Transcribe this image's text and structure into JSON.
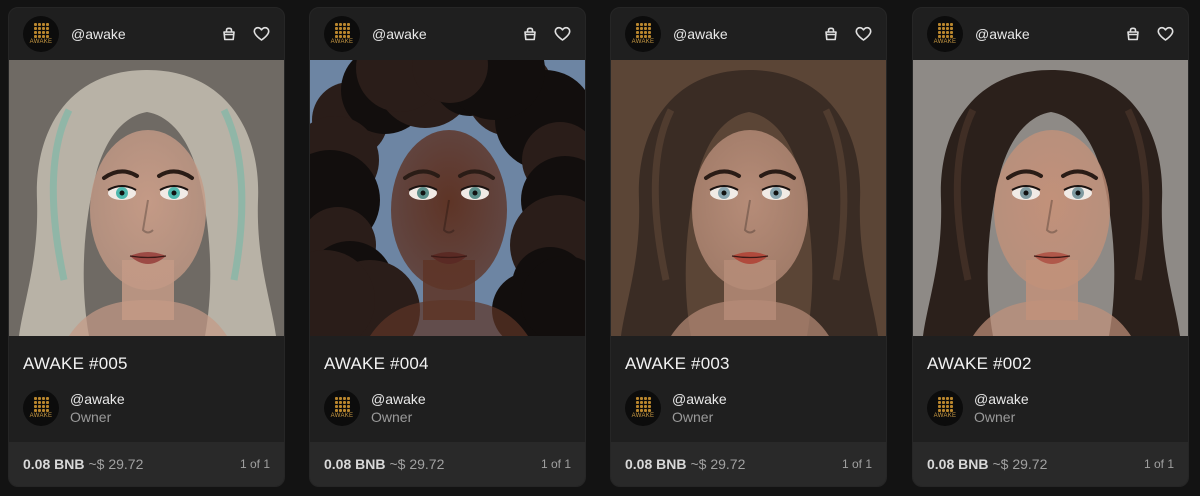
{
  "cards": [
    {
      "header_user": "@awake",
      "title": "AWAKE #005",
      "owner_name": "@awake",
      "owner_role": "Owner",
      "price": "0.08 BNB",
      "usd": "~$ 29.72",
      "edition": "1 of 1",
      "logo_text": "AWAKE",
      "palette": {
        "bg": "#6f6a64",
        "hair": "#b8b2a6",
        "hair_accent": "#7fb8a8",
        "skin": "#c49a86",
        "eyes": "#4fb8ae",
        "lips": "#9c4a44"
      }
    },
    {
      "header_user": "@awake",
      "title": "AWAKE #004",
      "owner_name": "@awake",
      "owner_role": "Owner",
      "price": "0.08 BNB",
      "usd": "~$ 29.72",
      "edition": "1 of 1",
      "logo_text": "AWAKE",
      "palette": {
        "bg": "#6d85a3",
        "hair": "#120e0d",
        "hair_accent": "#2a1d19",
        "skin": "#5e3426",
        "eyes": "#5c8f8a",
        "lips": "#5a2a24"
      }
    },
    {
      "header_user": "@awake",
      "title": "AWAKE #003",
      "owner_name": "@awake",
      "owner_role": "Owner",
      "price": "0.08 BNB",
      "usd": "~$ 29.72",
      "edition": "1 of 1",
      "logo_text": "AWAKE",
      "palette": {
        "bg": "#5b4536",
        "hair": "#3a2c24",
        "hair_accent": "#5a4334",
        "skin": "#b68c78",
        "eyes": "#8aa6b0",
        "lips": "#b04a3c"
      }
    },
    {
      "header_user": "@awake",
      "title": "AWAKE #002",
      "owner_name": "@awake",
      "owner_role": "Owner",
      "price": "0.08 BNB",
      "usd": "~$ 29.72",
      "edition": "1 of 1",
      "logo_text": "AWAKE",
      "palette": {
        "bg": "#8e8a86",
        "hair": "#2b201b",
        "hair_accent": "#4a3529",
        "skin": "#c2917a",
        "eyes": "#7f9aa0",
        "lips": "#b0584a"
      }
    }
  ]
}
